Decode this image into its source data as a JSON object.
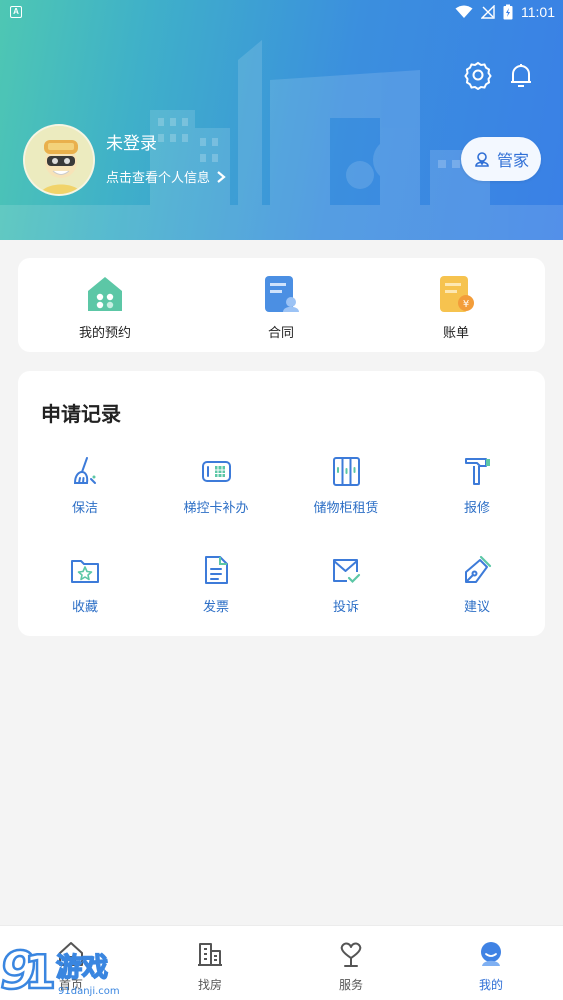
{
  "status_bar": {
    "time": "11:01",
    "notice_glyph": "A"
  },
  "header": {
    "login_title": "未登录",
    "login_subtitle": "点击查看个人信息",
    "butler_button": "管家",
    "icons": [
      "gear-icon",
      "bell-icon"
    ]
  },
  "quick_actions": [
    {
      "label": "我的预约",
      "icon": "house-appointment-icon"
    },
    {
      "label": "合同",
      "icon": "contract-icon"
    },
    {
      "label": "账单",
      "icon": "bill-icon"
    }
  ],
  "records": {
    "title": "申请记录",
    "items": [
      {
        "label": "保洁",
        "icon": "broom-icon"
      },
      {
        "label": "梯控卡补办",
        "icon": "elevator-card-icon"
      },
      {
        "label": "储物柜租赁",
        "icon": "locker-icon"
      },
      {
        "label": "报修",
        "icon": "hammer-icon"
      },
      {
        "label": "收藏",
        "icon": "favorite-folder-icon"
      },
      {
        "label": "发票",
        "icon": "invoice-icon"
      },
      {
        "label": "投诉",
        "icon": "complaint-mail-icon"
      },
      {
        "label": "建议",
        "icon": "pen-icon"
      }
    ]
  },
  "bottom_nav": [
    {
      "label": "首页",
      "icon": "home-icon",
      "active": false
    },
    {
      "label": "找房",
      "icon": "building-icon",
      "active": false
    },
    {
      "label": "服务",
      "icon": "heart-hand-icon",
      "active": false
    },
    {
      "label": "我的",
      "icon": "profile-icon",
      "active": true
    }
  ],
  "watermark": {
    "text": "游戏",
    "sub": "91danji.com",
    "number": "9"
  },
  "colors": {
    "accent": "#2f6fd6",
    "label_blue": "#2d6fc6",
    "header_start": "#4ec7b3",
    "header_end": "#3a80e6"
  }
}
